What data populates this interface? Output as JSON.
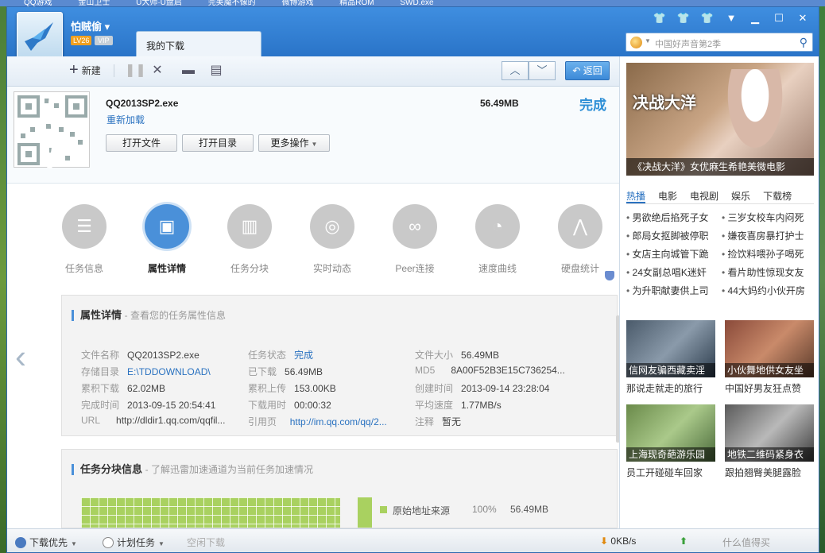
{
  "desktop": {
    "top_items": [
      "QQ游戏",
      "金山卫士",
      "U大师·U盘启",
      "完美魔不像的",
      "微博游戏",
      "精品ROM",
      "SWD.exe"
    ]
  },
  "window": {
    "user_name": "怕贼偷",
    "level_badge": "LV26",
    "vip_badge": "VIP",
    "active_tab": "我的下载",
    "search_placeholder": "中国好声音第2季"
  },
  "toolbar": {
    "new_label": "新建",
    "back_label": "返回"
  },
  "file": {
    "name": "QQ2013SP2.exe",
    "size": "56.49MB",
    "status": "完成",
    "reload": "重新加载",
    "btn_open_file": "打开文件",
    "btn_open_dir": "打开目录",
    "btn_more": "更多操作"
  },
  "categories": [
    {
      "label": "任务信息",
      "icon": "list-icon"
    },
    {
      "label": "属性详情",
      "icon": "info-icon"
    },
    {
      "label": "任务分块",
      "icon": "bar-chart-icon"
    },
    {
      "label": "实时动态",
      "icon": "target-icon"
    },
    {
      "label": "Peer连接",
      "icon": "link-icon"
    },
    {
      "label": "速度曲线",
      "icon": "gauge-icon"
    },
    {
      "label": "硬盘统计",
      "icon": "line-chart-icon"
    }
  ],
  "details": {
    "title": "属性详情",
    "subtitle": "- 查看您的任务属性信息",
    "rows": [
      [
        {
          "k": "文件名称",
          "v": "QQ2013SP2.exe"
        },
        {
          "k": "任务状态",
          "v": "完成",
          "style": "blue"
        },
        {
          "k": "文件大小",
          "v": "56.49MB"
        }
      ],
      [
        {
          "k": "存储目录",
          "v": "E:\\TDDOWNLOAD\\",
          "style": "link"
        },
        {
          "k": "已下载",
          "v": "56.49MB"
        },
        {
          "k": "MD5",
          "v": "8A00F52B3E15C736254..."
        }
      ],
      [
        {
          "k": "累积下载",
          "v": "62.02MB"
        },
        {
          "k": "累积上传",
          "v": "153.00KB"
        },
        {
          "k": "创建时间",
          "v": "2013-09-14 23:28:04"
        }
      ],
      [
        {
          "k": "完成时间",
          "v": "2013-09-15 20:54:41"
        },
        {
          "k": "下载用时",
          "v": "00:00:32"
        },
        {
          "k": "平均速度",
          "v": "1.77MB/s"
        }
      ],
      [
        {
          "k": "URL",
          "v": "http://dldir1.qq.com/qqfil..."
        },
        {
          "k": "引用页",
          "v": "http://im.qq.com/qq/2...",
          "style": "link"
        },
        {
          "k": "注释",
          "v": "暂无"
        }
      ]
    ]
  },
  "blocks": {
    "title": "任务分块信息",
    "subtitle": "- 了解迅雷加速通道为当前任务加速情况",
    "legend_label": "原始地址来源",
    "legend_percent": "100%",
    "legend_size": "56.49MB"
  },
  "sidebar": {
    "banner_caption": "《决战大洋》女优麻生希艳美微电影",
    "banner_art": "决战大洋",
    "tabs": [
      "热播",
      "电影",
      "电视剧",
      "娱乐",
      "下载榜"
    ],
    "news": [
      [
        "男欲绝后掐死子女",
        "三岁女校车内闷死"
      ],
      [
        "郎局女抠脚被停职",
        "嫌夜喜房暴打护士"
      ],
      [
        "女店主向城管下跪",
        "捡饮料喂孙子喝死"
      ],
      [
        "24女副总唱K迷奸",
        "看片助性惊现女友"
      ],
      [
        "为升职献妻供上司",
        "44大妈约小伙开房"
      ]
    ],
    "thumbs": [
      {
        "caption": "信网友骗西藏卖淫",
        "sub": "那说走就走的旅行"
      },
      {
        "caption": "小伙舞地供女友坐",
        "sub": "中国好男友狂点赞"
      },
      {
        "caption": "上海现奇葩游乐园",
        "sub": "员工开碰碰车回家"
      },
      {
        "caption": "地铁二维码紧身衣",
        "sub": "跟拍翘臀美腿露脸"
      }
    ]
  },
  "statusbar": {
    "priority": "下载优先",
    "plan": "计划任务",
    "idle": "空闲下载",
    "down_speed": "0KB/s",
    "up_label": "什么值得买"
  },
  "colors": {
    "accent": "#2a72c0",
    "titlebar": "#3f8ee0",
    "block_green": "#a9d160"
  }
}
